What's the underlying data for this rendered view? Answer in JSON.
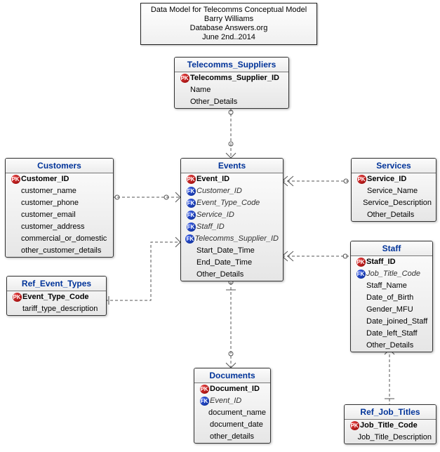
{
  "info": {
    "line1": "Data Model for Telecomms Conceptual Model",
    "line2": "Barry Williams",
    "line3": "Database Answers.org",
    "line4": "June 2nd..2014"
  },
  "entities": {
    "telecomms_suppliers": {
      "title": "Telecomms_Suppliers",
      "attrs": [
        {
          "key": "PK",
          "name": "Telecomms_Supplier_ID"
        },
        {
          "key": "",
          "name": "Name"
        },
        {
          "key": "",
          "name": "Other_Details"
        }
      ]
    },
    "customers": {
      "title": "Customers",
      "attrs": [
        {
          "key": "PK",
          "name": "Customer_ID"
        },
        {
          "key": "",
          "name": "customer_name"
        },
        {
          "key": "",
          "name": "customer_phone"
        },
        {
          "key": "",
          "name": "customer_email"
        },
        {
          "key": "",
          "name": "customer_address"
        },
        {
          "key": "",
          "name": "commercial_or_domestic"
        },
        {
          "key": "",
          "name": "other_customer_details"
        }
      ]
    },
    "events": {
      "title": "Events",
      "attrs": [
        {
          "key": "PK",
          "name": "Event_ID"
        },
        {
          "key": "FK",
          "name": "Customer_ID"
        },
        {
          "key": "FK",
          "name": "Event_Type_Code"
        },
        {
          "key": "FK",
          "name": "Service_ID"
        },
        {
          "key": "FK",
          "name": "Staff_ID"
        },
        {
          "key": "FK",
          "name": "Telecomms_Supplier_ID"
        },
        {
          "key": "",
          "name": "Start_Date_Time"
        },
        {
          "key": "",
          "name": "End_Date_Time"
        },
        {
          "key": "",
          "name": "Other_Details"
        }
      ]
    },
    "services": {
      "title": "Services",
      "attrs": [
        {
          "key": "PK",
          "name": "Service_ID"
        },
        {
          "key": "",
          "name": "Service_Name"
        },
        {
          "key": "",
          "name": "Service_Description"
        },
        {
          "key": "",
          "name": "Other_Details"
        }
      ]
    },
    "staff": {
      "title": "Staff",
      "attrs": [
        {
          "key": "PK",
          "name": "Staff_ID"
        },
        {
          "key": "FK",
          "name": "Job_Title_Code"
        },
        {
          "key": "",
          "name": "Staff_Name"
        },
        {
          "key": "",
          "name": "Date_of_Birth"
        },
        {
          "key": "",
          "name": "Gender_MFU"
        },
        {
          "key": "",
          "name": "Date_joined_Staff"
        },
        {
          "key": "",
          "name": "Date_left_Staff"
        },
        {
          "key": "",
          "name": "Other_Details"
        }
      ]
    },
    "ref_event_types": {
      "title": "Ref_Event_Types",
      "attrs": [
        {
          "key": "PK",
          "name": "Event_Type_Code"
        },
        {
          "key": "",
          "name": "tariff_type_description"
        }
      ]
    },
    "documents": {
      "title": "Documents",
      "attrs": [
        {
          "key": "PK",
          "name": "Document_ID"
        },
        {
          "key": "FK",
          "name": "Event_ID"
        },
        {
          "key": "",
          "name": "document_name"
        },
        {
          "key": "",
          "name": "document_date"
        },
        {
          "key": "",
          "name": "other_details"
        }
      ]
    },
    "ref_job_titles": {
      "title": "Ref_Job_Titles",
      "attrs": [
        {
          "key": "PK",
          "name": "Job_Title_Code"
        },
        {
          "key": "",
          "name": "Job_Title_Description"
        }
      ]
    }
  }
}
